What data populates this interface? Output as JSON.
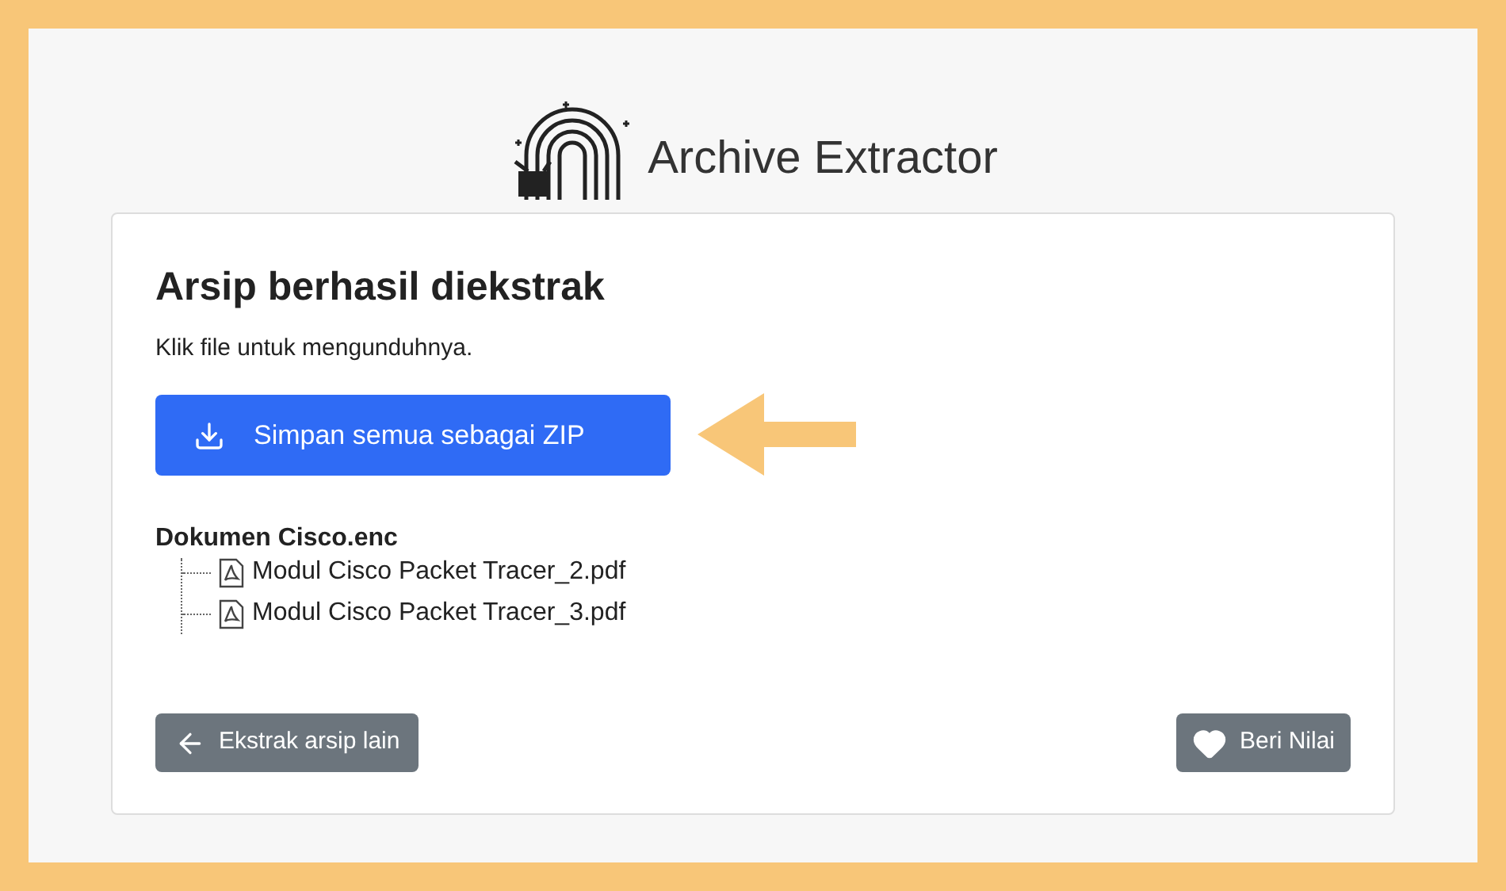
{
  "header": {
    "title": "Archive Extractor"
  },
  "card": {
    "heading": "Arsip berhasil diekstrak",
    "hint": "Klik file untuk mengunduhnya.",
    "download_button": "Simpan semua sebagai ZIP",
    "archive": {
      "name": "Dokumen Cisco.enc",
      "children": [
        {
          "name": "Modul Cisco Packet Tracer_2.pdf"
        },
        {
          "name": "Modul Cisco Packet Tracer_3.pdf"
        }
      ]
    },
    "back_button": "Ekstrak arsip lain",
    "rate_button": "Beri Nilai"
  }
}
